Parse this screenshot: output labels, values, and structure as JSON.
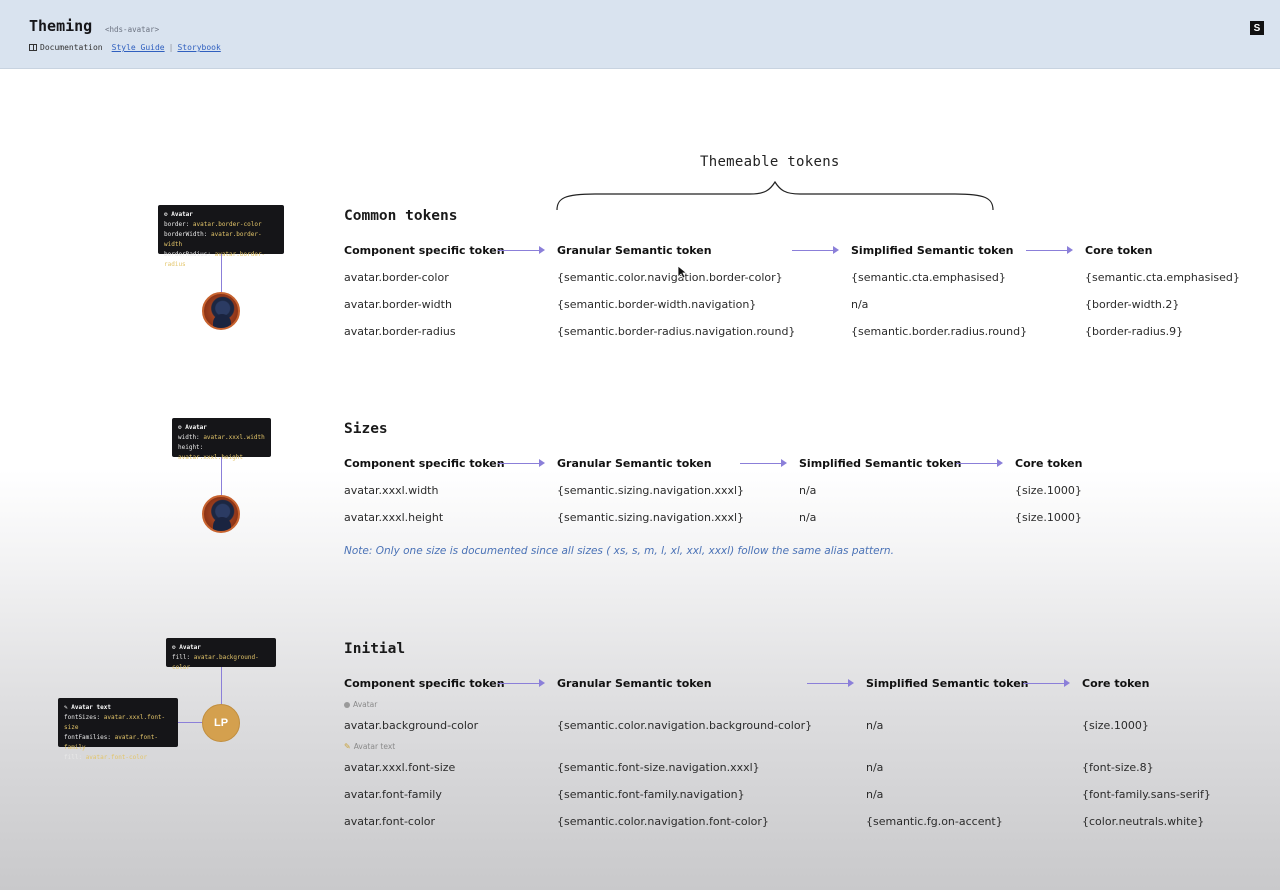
{
  "header": {
    "title": "Theming",
    "tag": "<hds-avatar>",
    "doc_label": "Documentation",
    "style_guide_label": "Style Guide",
    "separator": "|",
    "storybook_label": "Storybook",
    "badge": "S"
  },
  "themeable_label": "Themeable tokens",
  "columns": {
    "component": "Component specific token",
    "granular": "Granular Semantic token",
    "simplified": "Simplified Semantic token",
    "core": "Core token"
  },
  "common": {
    "title": "Common tokens",
    "rows": [
      [
        "avatar.border-color",
        "{semantic.color.navigation.border-color}",
        "{semantic.cta.emphasised}",
        "{semantic.cta.emphasised}"
      ],
      [
        "avatar.border-width",
        "{semantic.border-width.navigation}",
        "n/a",
        "{border-width.2}"
      ],
      [
        "avatar.border-radius",
        "{semantic.border-radius.navigation.round}",
        "{semantic.border.radius.round}",
        "{border-radius.9}"
      ]
    ],
    "code": {
      "title": "Avatar",
      "lines": [
        {
          "k": "border:",
          "v": "avatar.border-color"
        },
        {
          "k": "borderWidth:",
          "v": "avatar.border-width"
        },
        {
          "k": "borderRadius:",
          "v": "avatar.border-radius"
        }
      ]
    }
  },
  "sizes": {
    "title": "Sizes",
    "rows": [
      [
        "avatar.xxxl.width",
        "{semantic.sizing.navigation.xxxl}",
        "n/a",
        "{size.1000}"
      ],
      [
        "avatar.xxxl.height",
        "{semantic.sizing.navigation.xxxl}",
        "n/a",
        "{size.1000}"
      ]
    ],
    "note": "Note: Only one size is documented since all sizes ( xs, s, m, l, xl, xxl, xxxl) follow the same alias pattern.",
    "code": {
      "title": "Avatar",
      "lines": [
        {
          "k": "width:",
          "v": "avatar.xxxl.width"
        },
        {
          "k": "height:",
          "v": "avatar.xxxl.height"
        }
      ]
    }
  },
  "initial": {
    "title": "Initial",
    "group_avatar": "Avatar",
    "group_text": "Avatar text",
    "rows_avatar": [
      [
        "avatar.background-color",
        "{semantic.color.navigation.background-color}",
        "n/a",
        "{size.1000}"
      ]
    ],
    "rows_text": [
      [
        "avatar.xxxl.font-size",
        "{semantic.font-size.navigation.xxxl}",
        "n/a",
        "{font-size.8}"
      ],
      [
        "avatar.font-family",
        "{semantic.font-family.navigation}",
        "n/a",
        "{font-family.sans-serif}"
      ],
      [
        "avatar.font-color",
        "{semantic.color.navigation.font-color}",
        "{semantic.fg.on-accent}",
        "{color.neutrals.white}"
      ]
    ],
    "code": {
      "title": "Avatar",
      "lines": [
        {
          "k": "fill:",
          "v": "avatar.background-color"
        }
      ]
    },
    "code_text": {
      "title": "Avatar text",
      "lines": [
        {
          "k": "fontSizes:",
          "v": "avatar.xxxl.font-size"
        },
        {
          "k": "fontFamilies:",
          "v": "avatar.font-family"
        },
        {
          "k": "fill:",
          "v": "avatar.font-color"
        }
      ]
    },
    "avatar_initials": "LP"
  },
  "colors": {
    "accent_arrow": "#8b7fd9",
    "note_blue": "#4a72b6",
    "code_value": "#e3c56a",
    "initial_avatar": "#d4a04e"
  }
}
